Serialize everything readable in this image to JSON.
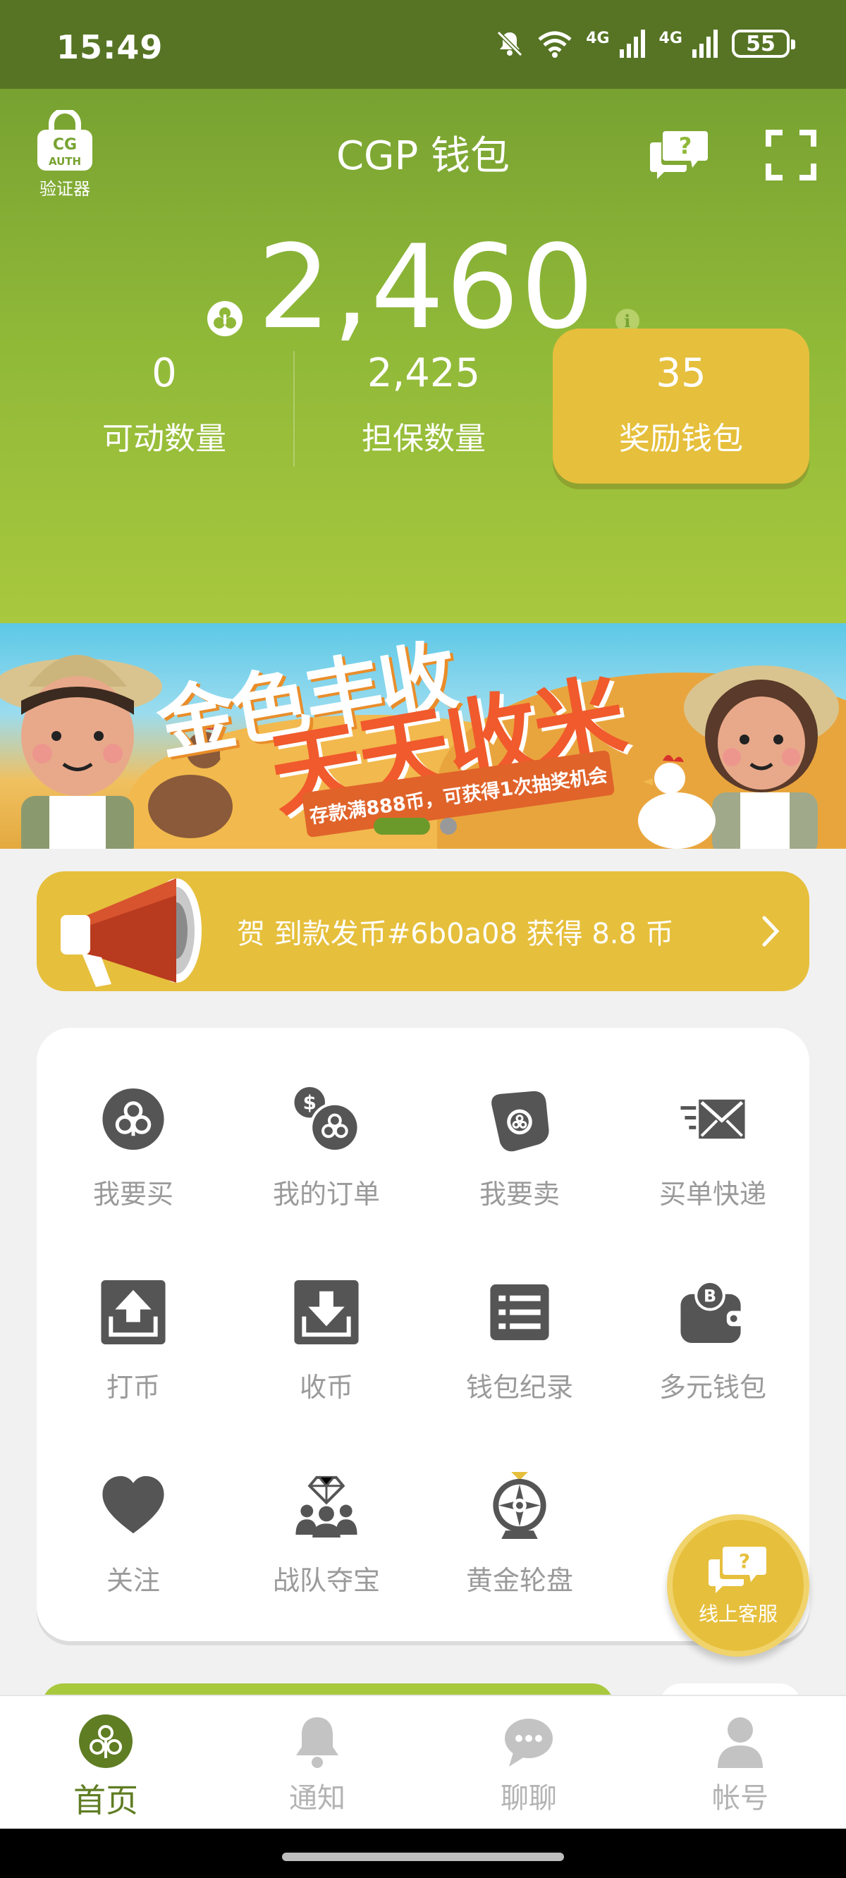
{
  "status_bar": {
    "time": "15:49",
    "signal1": "4G",
    "signal2": "4G",
    "battery": "55"
  },
  "header": {
    "auth_caption": "验证器",
    "title": "CGP 钱包",
    "balance": "2,460",
    "info": "i"
  },
  "stats": {
    "movable": {
      "value": "0",
      "label": "可动数量"
    },
    "guarantee": {
      "value": "2,425",
      "label": "担保数量"
    },
    "reward": {
      "value": "35",
      "label": "奖励钱包"
    }
  },
  "banner": {
    "title_line1": "金色丰收",
    "title_line2": "天天收米",
    "ribbon": "存款满888币，可获得1次抽奖机会"
  },
  "notice": {
    "text": "贺 到款发币#6b0a08 获得 8.8 币"
  },
  "menu": {
    "items": [
      {
        "label": "我要买",
        "icon": "coin-icon"
      },
      {
        "label": "我的订单",
        "icon": "orders-icon"
      },
      {
        "label": "我要卖",
        "icon": "sell-tag-icon"
      },
      {
        "label": "买单快递",
        "icon": "express-mail-icon"
      },
      {
        "label": "打币",
        "icon": "upload-icon"
      },
      {
        "label": "收币",
        "icon": "download-icon"
      },
      {
        "label": "钱包纪录",
        "icon": "list-icon"
      },
      {
        "label": "多元钱包",
        "icon": "wallet-icon"
      },
      {
        "label": "关注",
        "icon": "heart-icon"
      },
      {
        "label": "战队夺宝",
        "icon": "team-diamond-icon"
      },
      {
        "label": "黄金轮盘",
        "icon": "roulette-icon"
      }
    ]
  },
  "customer_service": {
    "label": "线上客服"
  },
  "nav": {
    "items": [
      {
        "label": "首页",
        "icon": "home-icon"
      },
      {
        "label": "通知",
        "icon": "bell-icon"
      },
      {
        "label": "聊聊",
        "icon": "chat-icon"
      },
      {
        "label": "帐号",
        "icon": "person-icon"
      }
    ]
  },
  "colors": {
    "status_bar": "#567424",
    "header_green": "#8fb838",
    "gold": "#e6bf3c",
    "icon_gray": "#555555",
    "active_green": "#5f7d23"
  }
}
